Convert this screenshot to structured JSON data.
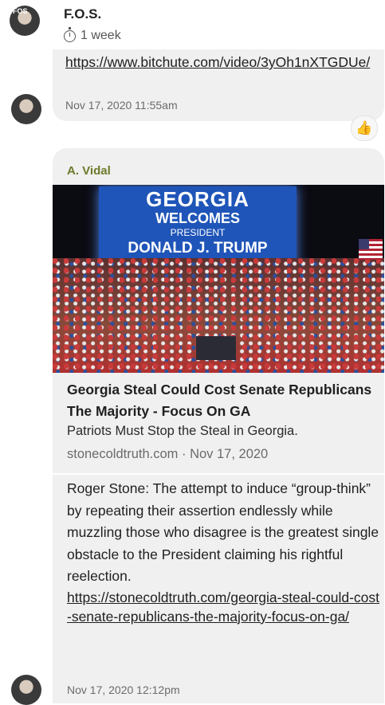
{
  "header": {
    "name": "F.O.S.",
    "time": "1 week",
    "avatar_badge": "FOS"
  },
  "message1": {
    "link": "https://www.bitchute.com/video/3yOh1nXTGDUe/",
    "timestamp": "Nov 17, 2020 11:55am",
    "reaction": "👍"
  },
  "message2": {
    "sender": "A. Vidal",
    "image_text": {
      "line1": "GEORGIA",
      "line2": "WELCOMES",
      "line3": "PRESIDENT",
      "line4": "DONALD J. TRUMP"
    },
    "card_title": "Georgia Steal Could Cost Senate Republicans The Majority - Focus On GA",
    "card_description": "Patriots Must Stop the Steal in Georgia.",
    "card_source": "stonecoldtruth.com · Nov 17, 2020",
    "body": "Roger Stone:  The attempt to induce “group-think” by repeating their assertion endlessly while muzzling those who disagree is the greatest single obstacle to the President claiming his rightful reelection.",
    "link": "https://stonecoldtruth.com/georgia-steal-could-cost-senate-republicans-the-majority-focus-on-ga/",
    "timestamp": "Nov 17, 2020 12:12pm"
  },
  "colors": {
    "bubble_bg": "#f0f0f0",
    "sender_color": "#6d7a2a",
    "screen_blue": "#1f55b8"
  }
}
